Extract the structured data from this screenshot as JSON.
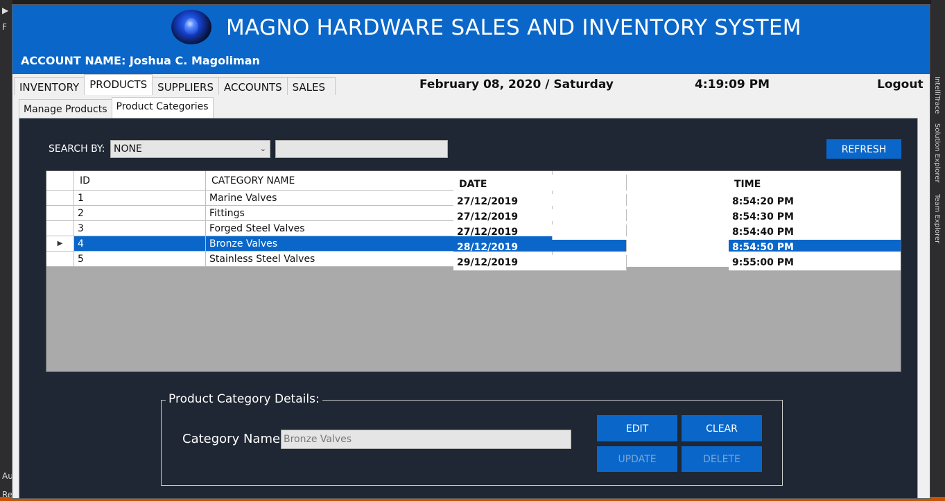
{
  "ide": {
    "left_glyphs": [
      "▶",
      "F",
      "Au",
      "Re"
    ],
    "right_labels": [
      "IntelliTrace",
      "Solution Explorer",
      "Team Explorer"
    ]
  },
  "header": {
    "title": "MAGNO HARDWARE SALES AND INVENTORY SYSTEM",
    "account": "ACCOUNT NAME: Joshua C. Magoliman"
  },
  "nav": {
    "tabs": [
      {
        "label": "INVENTORY"
      },
      {
        "label": "PRODUCTS"
      },
      {
        "label": "SUPPLIERS"
      },
      {
        "label": "ACCOUNTS"
      },
      {
        "label": "SALES"
      }
    ],
    "active_tab": "PRODUCTS",
    "date": "February 08, 2020 / Saturday",
    "time": "4:19:09 PM",
    "logout": "Logout"
  },
  "subtabs": [
    {
      "label": "Manage Products"
    },
    {
      "label": "Product Categories"
    }
  ],
  "search": {
    "label": "SEARCH BY:",
    "selected": "NONE",
    "value": "",
    "refresh_label": "REFRESH"
  },
  "table": {
    "columns": [
      "ID",
      "CATEGORY NAME",
      "DATE",
      "TIME"
    ],
    "rows": [
      {
        "id": "1",
        "name": "Marine Valves",
        "date": "27/12/2019",
        "time": "8:54:20 PM"
      },
      {
        "id": "2",
        "name": "Fittings",
        "date": "27/12/2019",
        "time": "8:54:30 PM"
      },
      {
        "id": "3",
        "name": "Forged Steel Valves",
        "date": "27/12/2019",
        "time": "8:54:40 PM"
      },
      {
        "id": "4",
        "name": "Bronze Valves",
        "date": "28/12/2019",
        "time": "8:54:50 PM"
      },
      {
        "id": "5",
        "name": "Stainless Steel Valves",
        "date": "29/12/2019",
        "time": "9:55:00 PM"
      }
    ],
    "selected_row_marker": "▶"
  },
  "details": {
    "legend": "Product Category Details:",
    "category_label": "Category Name:",
    "category_value": "Bronze Valves",
    "edit": "EDIT",
    "clear": "CLEAR",
    "update": "UPDATE",
    "delete": "DELETE"
  },
  "colors": {
    "header_blue": "#0a67c9",
    "panel_dark": "#1e2733",
    "grid_empty": "#aaaaaa"
  }
}
